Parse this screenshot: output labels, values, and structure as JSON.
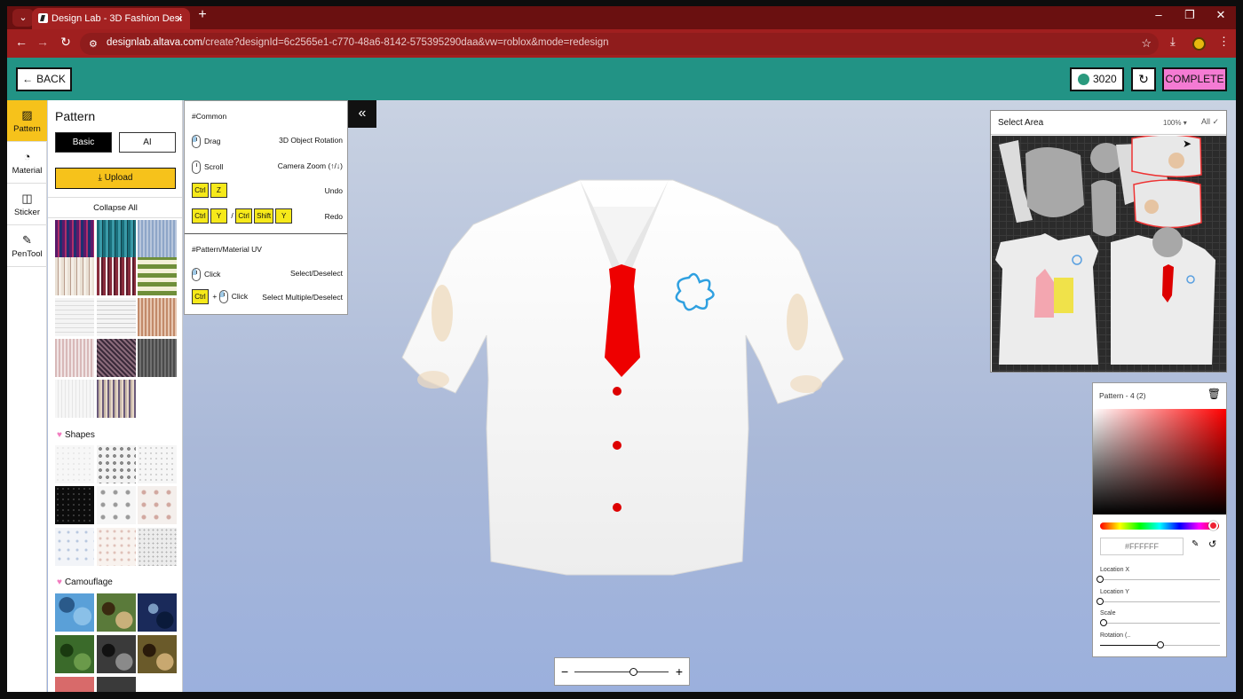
{
  "browser": {
    "tab_title": "Design Lab - 3D Fashion Desi",
    "url_host": "designlab.altava.com",
    "url_path": "/create?designId=6c2565e1-c770-48a6-8142-575395290daa&vw=roblox&mode=redesign"
  },
  "header": {
    "back_label": "BACK",
    "credits": "3020",
    "complete_label": "COMPLETE"
  },
  "leftnav": {
    "items": [
      {
        "label": "Pattern",
        "icon": "pattern-icon"
      },
      {
        "label": "Material",
        "icon": "material-icon"
      },
      {
        "label": "Sticker",
        "icon": "sticker-icon"
      },
      {
        "label": "PenTool",
        "icon": "pen-icon"
      }
    ]
  },
  "panel": {
    "title": "Pattern",
    "tab_basic": "Basic",
    "tab_ai": "AI",
    "upload_label": "Upload",
    "collapse_label": "Collapse All",
    "section_shapes": "Shapes",
    "section_camouflage": "Camouflage"
  },
  "shortcuts": {
    "common_head": "#Common",
    "drag": "Drag",
    "drag_action": "3D Object Rotation",
    "scroll": "Scroll",
    "scroll_action": "Camera Zoom (↑/↓)",
    "undo_keys": [
      "Ctrl",
      "Z"
    ],
    "undo_action": "Undo",
    "redo_keys_a": [
      "Ctrl",
      "Y"
    ],
    "redo_sep": "/",
    "redo_keys_b": [
      "Ctrl",
      "Shift",
      "Y"
    ],
    "redo_action": "Redo",
    "uv_head": "#Pattern/Material UV",
    "click": "Click",
    "click_action": "Select/Deselect",
    "multi_key": "Ctrl",
    "multi_plus": "+",
    "multi_click": "Click",
    "multi_action": "Select Multiple/Deselect"
  },
  "uv": {
    "title": "Select Area",
    "zoom": "100%",
    "all_label": "All"
  },
  "colorpanel": {
    "title": "Pattern - 4 (2)",
    "hex_placeholder": "#FFFFFF",
    "location_x_label": "Location X",
    "location_y_label": "Location Y",
    "scale_label": "Scale",
    "rotation_label": "Rotation (..",
    "location_x": 0,
    "location_y": 0,
    "scale": 0.03,
    "rotation": 0.5
  },
  "zoom": {
    "value": 0.62
  },
  "colors": {
    "header": "#229385",
    "accent": "#f6c21b",
    "complete": "#f47bd3",
    "chrome": "#a01f1f"
  }
}
